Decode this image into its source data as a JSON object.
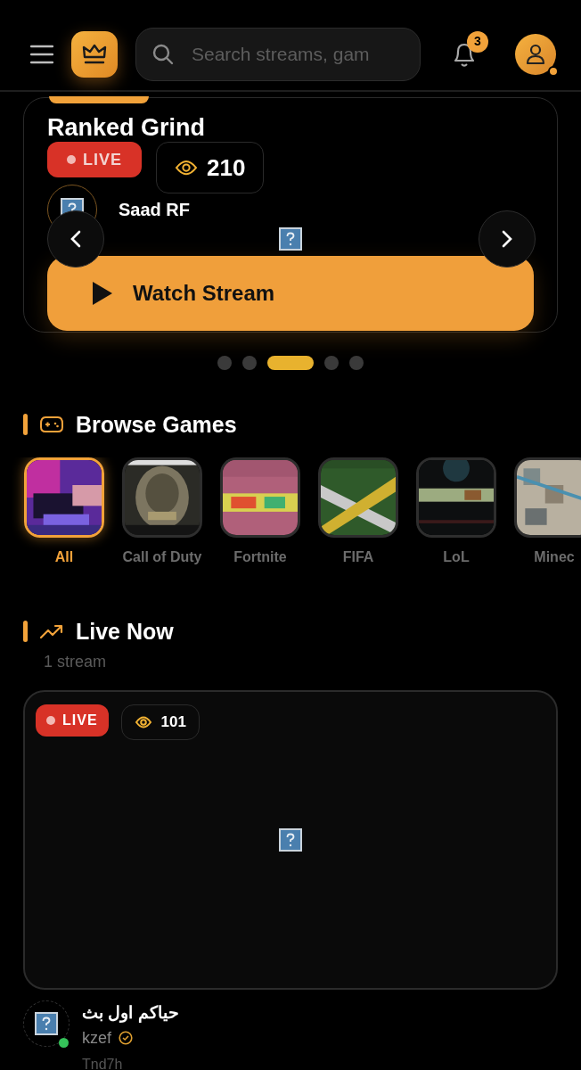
{
  "header": {
    "search": {
      "placeholder": "Search streams, gam"
    },
    "notifications": {
      "count": "3"
    },
    "profile": {
      "online": true
    }
  },
  "hero": {
    "title": "Ranked Grind",
    "live_label": "LIVE",
    "viewers": "210",
    "streamer": "Saad RF",
    "button": "Watch Stream",
    "dots": [
      {
        "selected": false
      },
      {
        "selected": false
      },
      {
        "selected": true
      },
      {
        "selected": false
      },
      {
        "selected": false
      }
    ]
  },
  "browse": {
    "title": "Browse Games",
    "games": [
      {
        "label": "All",
        "selected": true,
        "kind": "picture"
      },
      {
        "label": "Call of Duty",
        "selected": false,
        "kind": "picture"
      },
      {
        "label": "Fortnite",
        "selected": false,
        "kind": "picture"
      },
      {
        "label": "FIFA",
        "selected": false,
        "kind": "picture"
      },
      {
        "label": "LoL",
        "selected": false,
        "kind": "picture"
      },
      {
        "label": "Minec",
        "selected": false,
        "kind": "picture"
      }
    ]
  },
  "live_now": {
    "title": "Live Now",
    "count": "1 stream",
    "streams": [
      {
        "live_label": "LIVE",
        "viewers": "101",
        "title": "حياكم اول بث",
        "streamer": "kzef",
        "verified": true,
        "online": true,
        "game": "Tnd7h"
      }
    ]
  }
}
